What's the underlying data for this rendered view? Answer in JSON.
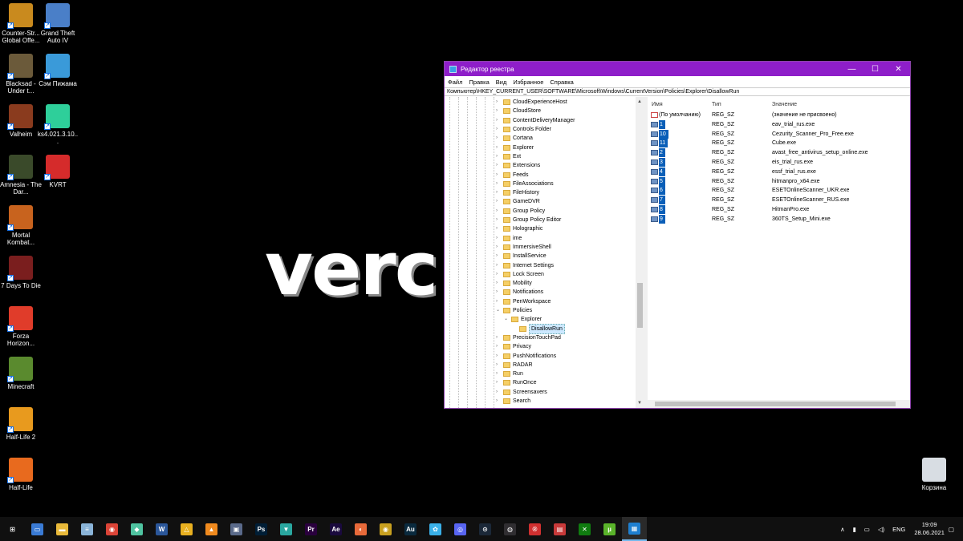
{
  "desktop": {
    "background_text": "verc",
    "icons": [
      {
        "label": "Counter-Str... Global Offe...",
        "icon": "csgo-icon",
        "color": "#c98a1e"
      },
      {
        "label": "Grand Theft Auto IV",
        "icon": "gta4-icon",
        "color": "#4a7fc8"
      },
      {
        "label": "Blacksad - Under t...",
        "icon": "blacksad-icon",
        "color": "#6b5a3a"
      },
      {
        "label": "Сэм Пижама",
        "icon": "sam-pajama-icon",
        "color": "#3a9ad9"
      },
      {
        "label": "Valheim",
        "icon": "valheim-icon",
        "color": "#8a3b1e"
      },
      {
        "label": "ks4.021.3.10...",
        "icon": "ks-cube-icon",
        "color": "#2ecf9a"
      },
      {
        "label": "Amnesia - The Dar...",
        "icon": "amnesia-icon",
        "color": "#3a4a2a"
      },
      {
        "label": "KVRT",
        "icon": "kvrt-icon",
        "color": "#d52b2b"
      },
      {
        "label": "Mortal Kombat...",
        "icon": "mortal-kombat-icon",
        "color": "#c8631e"
      },
      {
        "label": "7 Days To Die",
        "icon": "7days-icon",
        "color": "#7a1e1e"
      },
      {
        "label": "Forza Horizon...",
        "icon": "forza-icon",
        "color": "#e03c2a"
      },
      {
        "label": "Minecraft",
        "icon": "minecraft-icon",
        "color": "#5a8a2e"
      },
      {
        "label": "Half-Life 2",
        "icon": "half-life2-icon",
        "color": "#e89a1e"
      },
      {
        "label": "Half-Life",
        "icon": "half-life-icon",
        "color": "#e86a1e"
      },
      {
        "label": "Корзина",
        "icon": "recycle-bin-icon",
        "color": "#d8dde3"
      }
    ]
  },
  "window": {
    "title": "Редактор реестра",
    "menu": [
      "Файл",
      "Правка",
      "Вид",
      "Избранное",
      "Справка"
    ],
    "address": "Компьютер\\HKEY_CURRENT_USER\\SOFTWARE\\Microsoft\\Windows\\CurrentVersion\\Policies\\Explorer\\DisallowRun",
    "tree": [
      {
        "name": "CloudExperienceHost",
        "level": 0,
        "expander": ">"
      },
      {
        "name": "CloudStore",
        "level": 0,
        "expander": ">"
      },
      {
        "name": "ContentDeliveryManager",
        "level": 0,
        "expander": ">"
      },
      {
        "name": "Controls Folder",
        "level": 0,
        "expander": ">"
      },
      {
        "name": "Cortana",
        "level": 0,
        "expander": ">"
      },
      {
        "name": "Explorer",
        "level": 0,
        "expander": ">"
      },
      {
        "name": "Ext",
        "level": 0,
        "expander": ">"
      },
      {
        "name": "Extensions",
        "level": 0,
        "expander": ">"
      },
      {
        "name": "Feeds",
        "level": 0,
        "expander": ">"
      },
      {
        "name": "FileAssociations",
        "level": 0,
        "expander": ">"
      },
      {
        "name": "FileHistory",
        "level": 0,
        "expander": ">"
      },
      {
        "name": "GameDVR",
        "level": 0,
        "expander": ">"
      },
      {
        "name": "Group Policy",
        "level": 0,
        "expander": ">"
      },
      {
        "name": "Group Policy Editor",
        "level": 0,
        "expander": ">"
      },
      {
        "name": "Holographic",
        "level": 0,
        "expander": ">"
      },
      {
        "name": "ime",
        "level": 0,
        "expander": ">"
      },
      {
        "name": "ImmersiveShell",
        "level": 0,
        "expander": ">"
      },
      {
        "name": "InstallService",
        "level": 0,
        "expander": ">"
      },
      {
        "name": "Internet Settings",
        "level": 0,
        "expander": ">"
      },
      {
        "name": "Lock Screen",
        "level": 0,
        "expander": ">"
      },
      {
        "name": "Mobility",
        "level": 0,
        "expander": ">"
      },
      {
        "name": "Notifications",
        "level": 0,
        "expander": ">"
      },
      {
        "name": "PenWorkspace",
        "level": 0,
        "expander": ">"
      },
      {
        "name": "Policies",
        "level": 0,
        "expander": "v"
      },
      {
        "name": "Explorer",
        "level": 1,
        "expander": "v"
      },
      {
        "name": "DisallowRun",
        "level": 2,
        "expander": "",
        "selected": true
      },
      {
        "name": "PrecisionTouchPad",
        "level": 0,
        "expander": ">"
      },
      {
        "name": "Privacy",
        "level": 0,
        "expander": ">"
      },
      {
        "name": "PushNotifications",
        "level": 0,
        "expander": ">"
      },
      {
        "name": "RADAR",
        "level": 0,
        "expander": ">"
      },
      {
        "name": "Run",
        "level": 0,
        "expander": ">"
      },
      {
        "name": "RunOnce",
        "level": 0,
        "expander": ">"
      },
      {
        "name": "Screensavers",
        "level": 0,
        "expander": ">"
      },
      {
        "name": "Search",
        "level": 0,
        "expander": ">"
      }
    ],
    "list_headers": {
      "name": "Имя",
      "type": "Тип",
      "value": "Значение"
    },
    "values": [
      {
        "name": "(По умолчанию)",
        "type": "REG_SZ",
        "data": "(значение не присвоено)",
        "highlight": false,
        "icon": "string-value-icon"
      },
      {
        "name": "1",
        "type": "REG_SZ",
        "data": "eav_trial_rus.exe",
        "highlight": true,
        "icon": "binary-value-icon"
      },
      {
        "name": "10",
        "type": "REG_SZ",
        "data": "Cezurity_Scanner_Pro_Free.exe",
        "highlight": true,
        "icon": "binary-value-icon"
      },
      {
        "name": "11",
        "type": "REG_SZ",
        "data": "Cube.exe",
        "highlight": true,
        "icon": "binary-value-icon"
      },
      {
        "name": "2",
        "type": "REG_SZ",
        "data": "avast_free_antivirus_setup_online.exe",
        "highlight": true,
        "icon": "binary-value-icon"
      },
      {
        "name": "3",
        "type": "REG_SZ",
        "data": "eis_trial_rus.exe",
        "highlight": true,
        "icon": "binary-value-icon"
      },
      {
        "name": "4",
        "type": "REG_SZ",
        "data": "essf_trial_rus.exe",
        "highlight": true,
        "icon": "binary-value-icon"
      },
      {
        "name": "5",
        "type": "REG_SZ",
        "data": "hitmanpro_x64.exe",
        "highlight": true,
        "icon": "binary-value-icon"
      },
      {
        "name": "6",
        "type": "REG_SZ",
        "data": "ESETOnlineScanner_UKR.exe",
        "highlight": true,
        "icon": "binary-value-icon"
      },
      {
        "name": "7",
        "type": "REG_SZ",
        "data": "ESETOnlineScanner_RUS.exe",
        "highlight": true,
        "icon": "binary-value-icon"
      },
      {
        "name": "8",
        "type": "REG_SZ",
        "data": "HitmanPro.exe",
        "highlight": true,
        "icon": "binary-value-icon"
      },
      {
        "name": "9",
        "type": "REG_SZ",
        "data": "360TS_Setup_Mini.exe",
        "highlight": true,
        "icon": "binary-value-icon"
      }
    ]
  },
  "taskbar": {
    "apps": [
      {
        "icon": "windows-start-icon",
        "glyph": "⊞",
        "color": "#101010"
      },
      {
        "icon": "task-view-icon",
        "glyph": "▭",
        "color": "#3a7bd5"
      },
      {
        "icon": "file-explorer-icon",
        "glyph": "▬",
        "color": "#e8b93a"
      },
      {
        "icon": "notepad-icon",
        "glyph": "≡",
        "color": "#8ab4d8"
      },
      {
        "icon": "chrome-icon",
        "glyph": "◉",
        "color": "#db4437"
      },
      {
        "icon": "app-icon",
        "glyph": "◆",
        "color": "#4fc3a0"
      },
      {
        "icon": "word-icon",
        "glyph": "W",
        "color": "#2b579a"
      },
      {
        "icon": "warning-app-icon",
        "glyph": "△",
        "color": "#e8b020"
      },
      {
        "icon": "vlc-icon",
        "glyph": "▲",
        "color": "#f08a1e"
      },
      {
        "icon": "monitor-app-icon",
        "glyph": "▣",
        "color": "#5a6a8a"
      },
      {
        "icon": "photoshop-icon",
        "glyph": "Ps",
        "color": "#001e36"
      },
      {
        "icon": "installer-icon",
        "glyph": "▼",
        "color": "#2aa7a0"
      },
      {
        "icon": "premiere-icon",
        "glyph": "Pr",
        "color": "#2a003e"
      },
      {
        "icon": "after-effects-icon",
        "glyph": "Ae",
        "color": "#1a0a3e"
      },
      {
        "icon": "paint-icon",
        "glyph": "◐",
        "color": "#e86a3a"
      },
      {
        "icon": "media-icon",
        "glyph": "◉",
        "color": "#c8a020"
      },
      {
        "icon": "audition-icon",
        "glyph": "Au",
        "color": "#0a2a3e"
      },
      {
        "icon": "network-icon",
        "glyph": "✿",
        "color": "#3ab0e8"
      },
      {
        "icon": "discord-icon",
        "glyph": "◎",
        "color": "#5865f2"
      },
      {
        "icon": "steam-icon",
        "glyph": "⊙",
        "color": "#1b2838"
      },
      {
        "icon": "obs-icon",
        "glyph": "◍",
        "color": "#302e31"
      },
      {
        "icon": "red-app-icon",
        "glyph": "®",
        "color": "#d03030"
      },
      {
        "icon": "flag-app-icon",
        "glyph": "▤",
        "color": "#c83a3a"
      },
      {
        "icon": "xbox-icon",
        "glyph": "✕",
        "color": "#107c10"
      },
      {
        "icon": "utorrent-icon",
        "glyph": "µ",
        "color": "#5ab32a"
      },
      {
        "icon": "regedit-icon",
        "glyph": "▦",
        "color": "#1e7fd0",
        "active": true
      }
    ],
    "tray": {
      "language": "ENG",
      "time": "19:09",
      "date": "28.06.2021"
    }
  }
}
